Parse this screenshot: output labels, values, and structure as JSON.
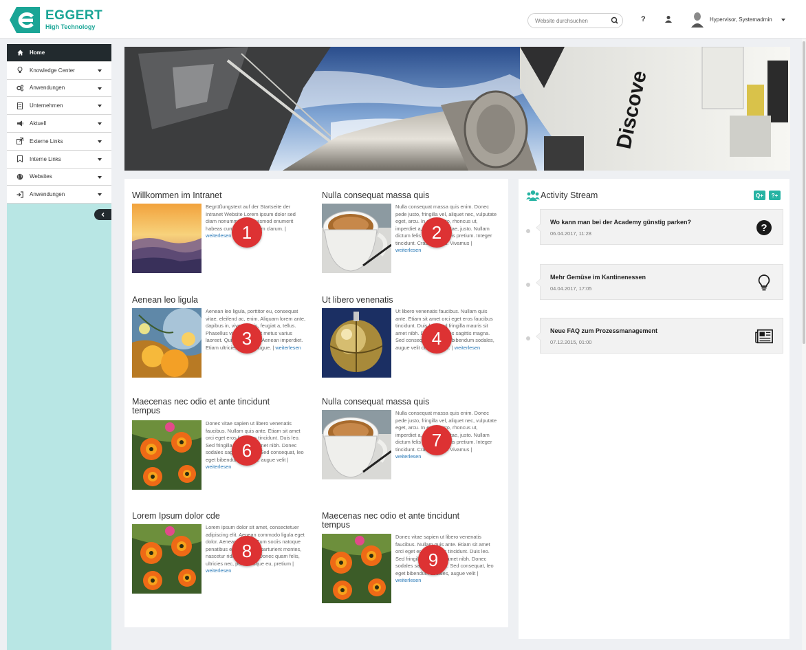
{
  "brand": {
    "name": "EGGERT",
    "tagline": "High Technology",
    "color": "#1aa596"
  },
  "header": {
    "search_placeholder": "Website durchsuchen",
    "help_label": "?",
    "user_name": "Hypervisor, Systemadmin"
  },
  "sidebar": {
    "items": [
      {
        "label": "Home",
        "icon": "home-icon",
        "active": true
      },
      {
        "label": "Knowledge Center",
        "icon": "lightbulb-icon"
      },
      {
        "label": "Anwendungen",
        "icon": "cogs-icon"
      },
      {
        "label": "Unternehmen",
        "icon": "building-icon"
      },
      {
        "label": "Aktuell",
        "icon": "megaphone-icon"
      },
      {
        "label": "Externe Links",
        "icon": "external-link-icon"
      },
      {
        "label": "Interne Links",
        "icon": "bookmark-icon"
      },
      {
        "label": "Websites",
        "icon": "globe-icon"
      },
      {
        "label": "Anwendungen",
        "icon": "sign-in-icon"
      }
    ],
    "collapse_icon": "chevron-left-icon",
    "background": "#b8e6e4"
  },
  "articles": [
    {
      "title": "Willkommen im Intranet",
      "text": "Begrüßungstext auf der Startseite der Intranet Website Lorem ipsum dolor sed diam nonummy nibh euismod enumerit habeas cum dolore assum clarum. |",
      "more": "weiterlesen",
      "badge": "1",
      "image": "sunset-mountains"
    },
    {
      "title": "Nulla consequat massa quis",
      "text": "Nulla consequat massa quis enim. Donec pede justo, fringilla vel, aliquet nec, vulputate eget, arcu. In enim justo, rhoncus ut, imperdiet a, venenatis vitae, justo. Nullam dictum felis eu pede mollis pretium. Integer tincidunt. Cras dapibus. Vivamus |",
      "more": "weiterlesen",
      "badge": "2",
      "image": "coffee-cup"
    },
    {
      "title": "Aenean leo ligula",
      "text": "Aenean leo ligula, porttitor eu, consequat vitae, eleifend ac, enim. Aliquam lorem ante, dapibus in, viverra quis, feugiat a, tellus. Phasellus viverra nulla ut metus varius laoreet. Quisque rutrum. Aenean imperdiet. Etiam ultricies nisi vel augue. |",
      "more": "weiterlesen",
      "badge": "3",
      "image": "yellow-flowers"
    },
    {
      "title": "Ut libero venenatis",
      "text": "Ut libero venenatis faucibus. Nullam quis ante. Etiam sit amet orci eget eros faucibus tincidunt. Duis leo. Sed fringilla mauris sit amet nibh. Donec sodales sagittis magna. Sed consequat, leo eget bibendum sodales, augue velit cursus nunc. |",
      "more": "weiterlesen",
      "badge": "4",
      "image": "golden-sphere"
    },
    {
      "title": "Maecenas nec odio et ante tincidunt tempus",
      "text": "Donec vitae sapien ut libero venenatis faucibus. Nullam quis ante. Etiam sit amet orci eget eros faucibus tincidunt. Duis leo. Sed fringilla mauris sit amet nibh. Donec sodales sagittis magna. Sed consequat, leo eget bibendum sodales, augue velit |",
      "more": "weiterlesen",
      "badge": "6",
      "image": "orange-flowers"
    },
    {
      "title": "Nulla consequat massa quis",
      "text": "Nulla consequat massa quis enim. Donec pede justo, fringilla vel, aliquet nec, vulputate eget, arcu. In enim justo, rhoncus ut, imperdiet a, venenatis vitae, justo. Nullam dictum felis eu pede mollis pretium. Integer tincidunt. Cras dapibus. Vivamus |",
      "more": "weiterlesen",
      "badge": "7",
      "image": "coffee-cup"
    },
    {
      "title": "Lorem Ipsum dolor cde",
      "text": "Lorem ipsum dolor sit amet, consectetuer adipiscing elit. Aenean commodo ligula eget dolor. Aenean massa. Cum sociis natoque penatibus et magnis dis parturient montes, nascetur ridiculus mus. Donec quam felis, ultricies nec, pellentesque eu, pretium |",
      "more": "weiterlesen",
      "badge": "8",
      "image": "orange-flowers"
    },
    {
      "title": "Maecenas nec odio et ante tincidunt tempus",
      "text": "Donec vitae sapien ut libero venenatis faucibus. Nullam quis ante. Etiam sit amet orci eget eros faucibus tincidunt. Duis leo. Sed fringilla mauris sit amet nibh. Donec sodales sagittis magna. Sed consequat, leo eget bibendum sodales, augue velit |",
      "more": "weiterlesen",
      "badge": "9",
      "image": "orange-flowers"
    }
  ],
  "activity": {
    "title": "Activity Stream",
    "buttons": [
      {
        "label": "Q+",
        "icon": "add-idea-icon"
      },
      {
        "label": "?+",
        "icon": "add-question-icon"
      }
    ],
    "items": [
      {
        "title": "Wo kann man bei der Academy günstig parken?",
        "date": "06.04.2017, 11:28",
        "icon": "question-circle-icon"
      },
      {
        "title": "Mehr Gemüse im Kantinenessen",
        "date": "04.04.2017, 17:05",
        "icon": "lightbulb-icon"
      },
      {
        "title": "Neue FAQ zum Prozessmanagement",
        "date": "07.12.2015, 01:00",
        "icon": "newspaper-icon"
      }
    ],
    "accent": "#26b3a3"
  },
  "badge_color": "#dd3233"
}
